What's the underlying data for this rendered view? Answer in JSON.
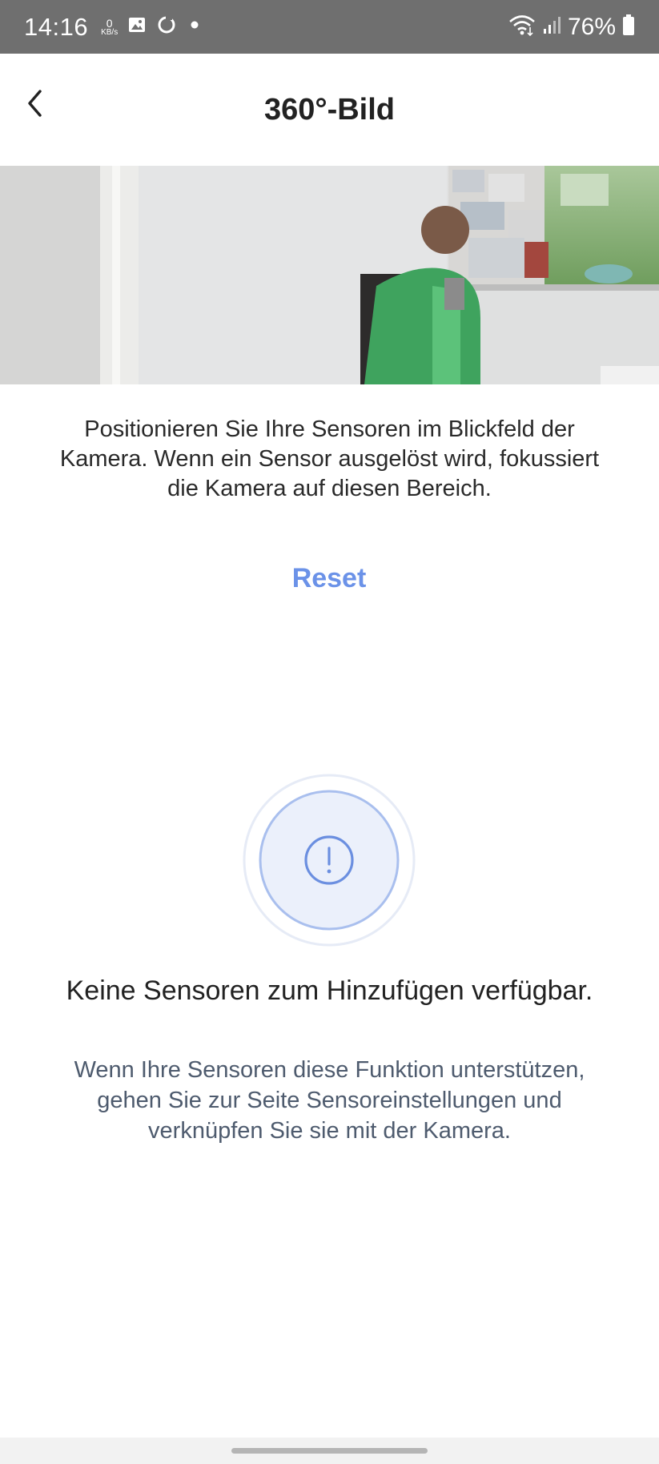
{
  "status_bar": {
    "time": "14:16",
    "net_speed_value": "0",
    "net_speed_unit": "KB/s",
    "battery": "76%",
    "icons": [
      "image-icon",
      "sync-icon",
      "dot-icon",
      "wifi-icon",
      "signal-icon",
      "battery-icon"
    ]
  },
  "header": {
    "title": "360°-Bild",
    "back_icon": "chevron-left-icon"
  },
  "camera": {
    "description": "360-degree camera preview image"
  },
  "instructions": "Positionieren Sie Ihre Sensoren im Blickfeld der Kamera. Wenn ein Sensor ausgelöst wird, fokussiert die Kamera auf diesen Bereich.",
  "reset_label": "Reset",
  "empty_state": {
    "icon": "exclamation-circle-icon",
    "title": "Keine Sensoren zum Hinzufügen verfügbar.",
    "description": "Wenn Ihre Sensoren diese Funktion unterstützen, gehen Sie zur Seite Sensoreinstellungen und verknüpfen Sie sie mit der Kamera."
  },
  "colors": {
    "accent": "#6b92e8",
    "status_bar": "#6f6f6f",
    "muted_text": "#4e5b6e"
  }
}
